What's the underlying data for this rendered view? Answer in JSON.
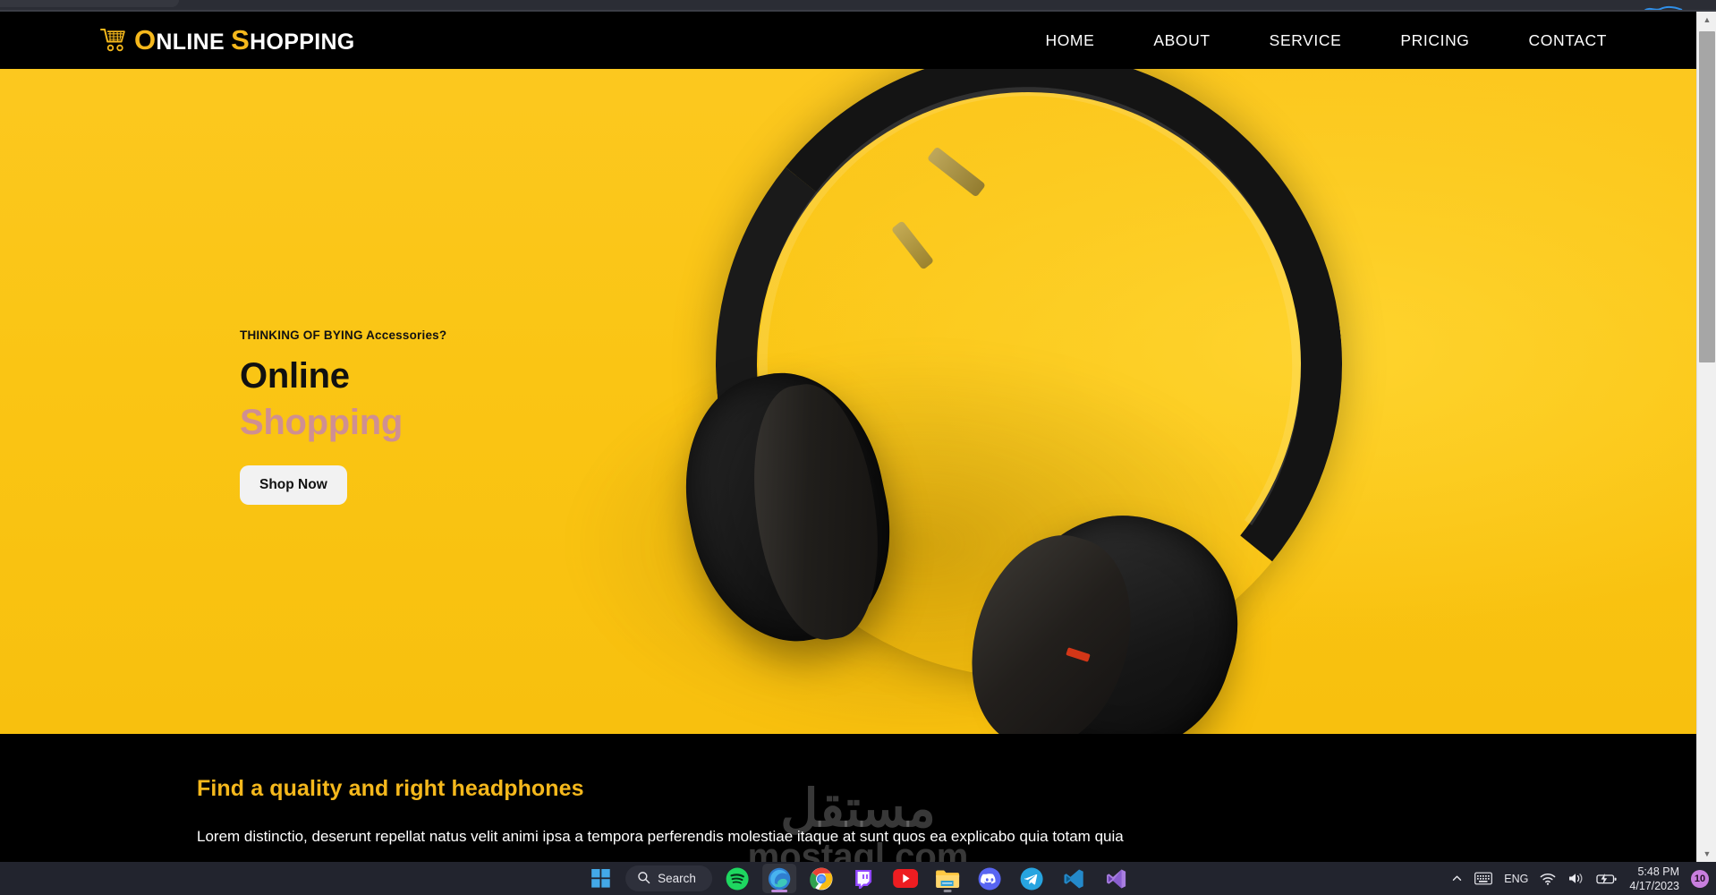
{
  "browser": {
    "scrollbar": {
      "up_arrow": "▲",
      "down_arrow": "▼"
    }
  },
  "site": {
    "header": {
      "brand": {
        "first_letter": "O",
        "first_rest": "NLINE",
        "second_letter": "S",
        "second_rest": "HOPPING",
        "cart_icon": "shopping-cart-icon"
      },
      "nav": [
        {
          "label": "HOME"
        },
        {
          "label": "ABOUT"
        },
        {
          "label": "SERVICE"
        },
        {
          "label": "PRICING"
        },
        {
          "label": "CONTACT"
        }
      ]
    },
    "hero": {
      "eyebrow": "THINKING OF BYING Accessories?",
      "title_line1": "Online",
      "title_line2": "Shopping",
      "cta_label": "Shop Now",
      "background_color": "#fac514",
      "title_line2_color": "#cf8f92"
    },
    "feature": {
      "heading": "Find a quality and right headphones",
      "heading_color": "#f5b81c",
      "body": "Lorem distinctio, deserunt repellat natus velit animi ipsa a tempora perferendis molestiae itaque at sunt quos ea explicabo quia totam quia"
    },
    "watermark": {
      "arabic": "مستقل",
      "latin": "mostaql.com"
    }
  },
  "taskbar": {
    "start_label": "start-button",
    "search_label": "Search",
    "apps": [
      {
        "name": "spotify",
        "active": false
      },
      {
        "name": "microsoft-edge",
        "active": true
      },
      {
        "name": "google-chrome",
        "active": false
      },
      {
        "name": "twitch",
        "active": false
      },
      {
        "name": "youtube",
        "active": false
      },
      {
        "name": "file-explorer",
        "active": false
      },
      {
        "name": "discord",
        "active": false
      },
      {
        "name": "telegram",
        "active": false
      },
      {
        "name": "visual-studio-code",
        "active": false
      },
      {
        "name": "visual-studio",
        "active": false
      }
    ],
    "tray": {
      "overflow_glyph": "⌃",
      "language": "ENG",
      "time": "5:48 PM",
      "date": "4/17/2023",
      "notification_count": "10"
    }
  }
}
